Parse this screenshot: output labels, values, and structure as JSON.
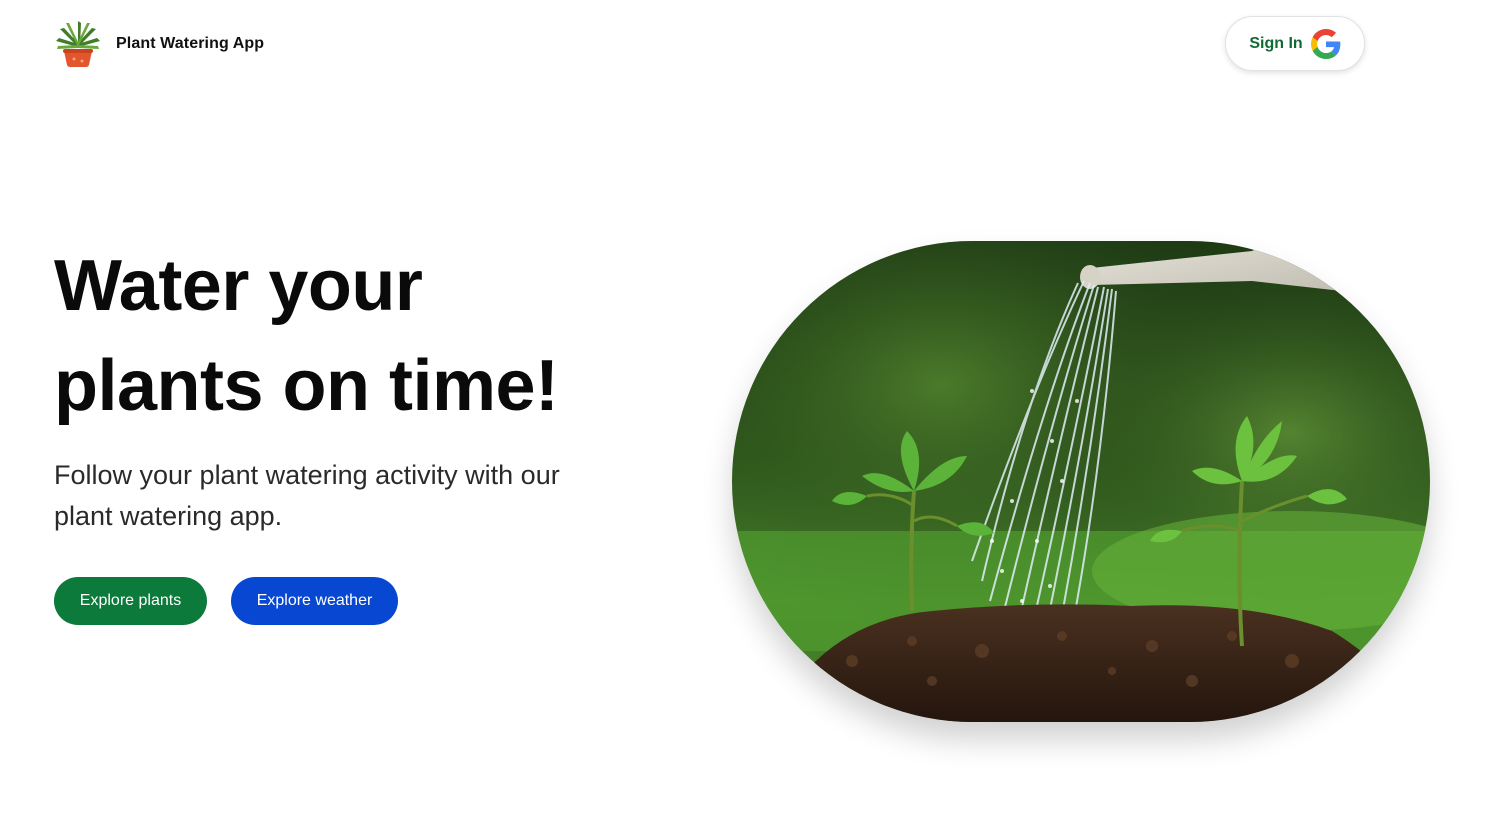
{
  "header": {
    "logo_icon": "potted-plant-icon",
    "app_title": "Plant Watering App",
    "sign_in_label": "Sign In",
    "sign_in_icon": "google-icon"
  },
  "hero": {
    "title_line1": "Water your",
    "title_line2": "plants on time!",
    "subtitle": "Follow your plant watering activity with our plant watering app.",
    "primary_button": "Explore plants",
    "secondary_button": "Explore weather",
    "image_subject": "watering-can-seedlings-image"
  },
  "colors": {
    "primary_green": "#0c7a3a",
    "secondary_blue": "#0747d2",
    "sign_in_text": "#0f6b33"
  }
}
